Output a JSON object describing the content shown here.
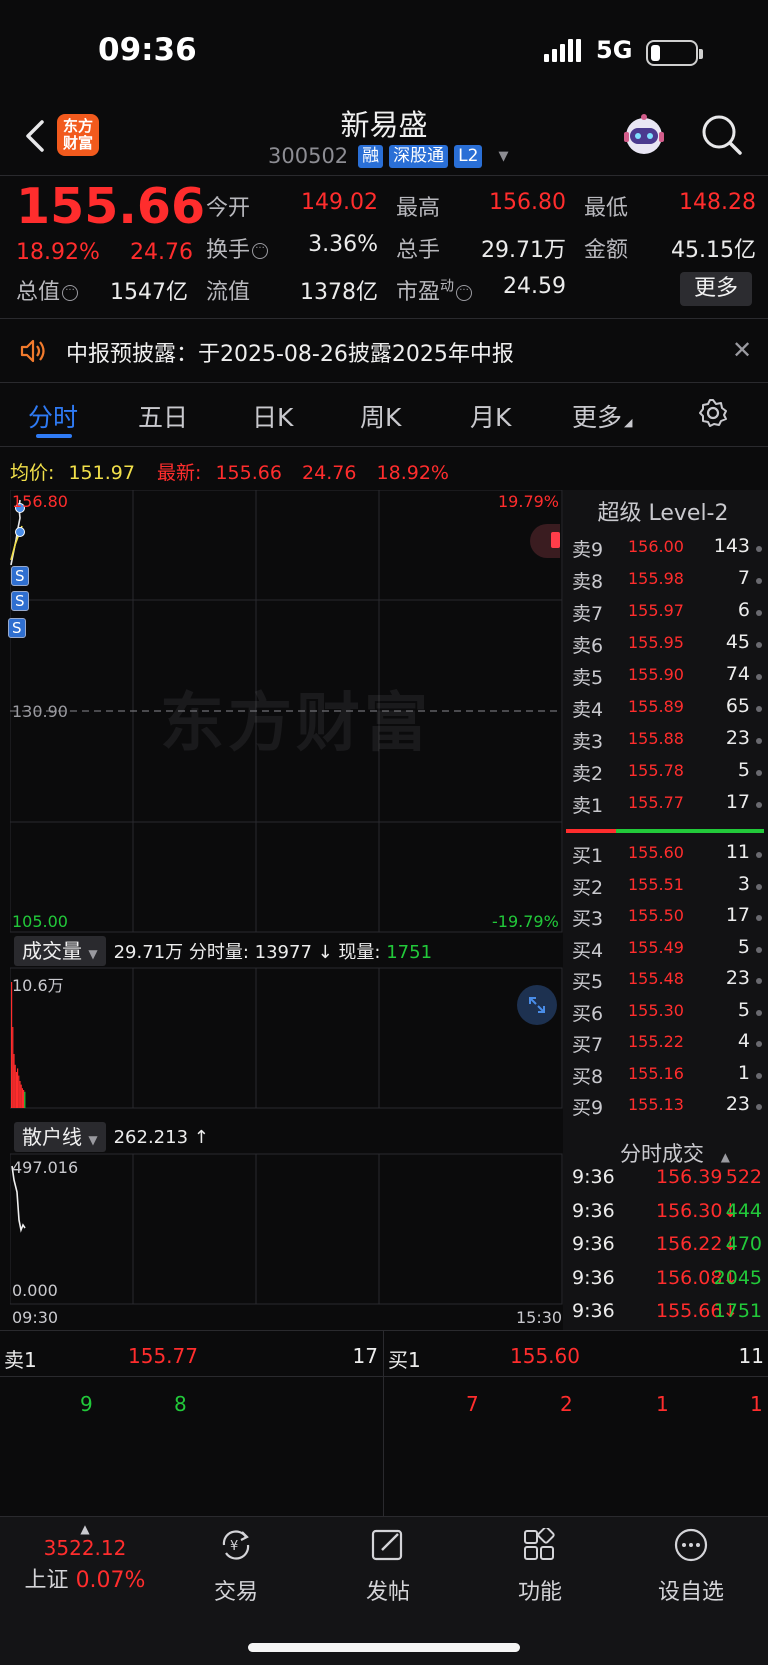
{
  "status_bar": {
    "time": "09:36",
    "network": "5G"
  },
  "header": {
    "stock_name": "新易盛",
    "stock_code": "300502",
    "tags": [
      "融",
      "深股通",
      "L2"
    ],
    "logo_text": [
      "东方",
      "财富"
    ]
  },
  "quote": {
    "price": "155.66",
    "change_pct": "18.92%",
    "change": "24.76",
    "fields": [
      {
        "label": "今开",
        "value": "149.02",
        "color": "red"
      },
      {
        "label": "最高",
        "value": "156.80",
        "color": "red"
      },
      {
        "label": "最低",
        "value": "148.28",
        "color": "red"
      },
      {
        "label": "换手",
        "value": "3.36%",
        "color": "white",
        "info": true
      },
      {
        "label": "总手",
        "value": "29.71万",
        "color": "white"
      },
      {
        "label": "金额",
        "value": "45.15亿",
        "color": "white"
      },
      {
        "label": "总值",
        "value": "1547亿",
        "color": "white",
        "info": true
      },
      {
        "label": "流值",
        "value": "1378亿",
        "color": "white"
      },
      {
        "label": "市盈",
        "sup": "动",
        "value": "24.59",
        "color": "white",
        "info": true
      }
    ],
    "more_label": "更多"
  },
  "notice": {
    "text": "中报预披露：于2025-08-26披露2025年中报"
  },
  "tabs": [
    "分时",
    "五日",
    "日K",
    "周K",
    "月K",
    "更多"
  ],
  "legend": {
    "avg_label": "均价:",
    "avg_value": "151.97",
    "latest_label": "最新:",
    "latest_value": "155.66",
    "latest_change": "24.76",
    "latest_pct": "18.92%"
  },
  "chart": {
    "watermark": "东方财富",
    "y_top": "156.80",
    "y_mid": "130.90",
    "y_bottom": "105.00",
    "pct_top": "19.79%",
    "pct_bottom": "-19.79%",
    "x_start": "09:30",
    "x_end": "15:30",
    "signals": [
      "S",
      "S",
      "S"
    ]
  },
  "volume": {
    "selector": "成交量",
    "summary": "29.71万 分时量: 13977 ↓ 现量:",
    "current": "1751",
    "max_label": "10.6万"
  },
  "retail": {
    "selector": "散户线",
    "value": "262.213 ↑",
    "max_label": "497.016",
    "min_label": "0.000"
  },
  "level2": {
    "title": "超级 Level-2",
    "asks": [
      {
        "label": "卖9",
        "price": "156.00",
        "vol": "143"
      },
      {
        "label": "卖8",
        "price": "155.98",
        "vol": "7"
      },
      {
        "label": "卖7",
        "price": "155.97",
        "vol": "6"
      },
      {
        "label": "卖6",
        "price": "155.95",
        "vol": "45"
      },
      {
        "label": "卖5",
        "price": "155.90",
        "vol": "74"
      },
      {
        "label": "卖4",
        "price": "155.89",
        "vol": "65"
      },
      {
        "label": "卖3",
        "price": "155.88",
        "vol": "23"
      },
      {
        "label": "卖2",
        "price": "155.78",
        "vol": "5"
      },
      {
        "label": "卖1",
        "price": "155.77",
        "vol": "17"
      }
    ],
    "bids": [
      {
        "label": "买1",
        "price": "155.60",
        "vol": "11"
      },
      {
        "label": "买2",
        "price": "155.51",
        "vol": "3"
      },
      {
        "label": "买3",
        "price": "155.50",
        "vol": "17"
      },
      {
        "label": "买4",
        "price": "155.49",
        "vol": "5"
      },
      {
        "label": "买5",
        "price": "155.48",
        "vol": "23"
      },
      {
        "label": "买6",
        "price": "155.30",
        "vol": "5"
      },
      {
        "label": "买7",
        "price": "155.22",
        "vol": "4"
      },
      {
        "label": "买8",
        "price": "155.16",
        "vol": "1"
      },
      {
        "label": "买9",
        "price": "155.13",
        "vol": "23"
      }
    ],
    "ticks_title": "分时成交",
    "ticks": [
      {
        "time": "9:36",
        "price": "156.39",
        "vol": "522",
        "vol_color": "red"
      },
      {
        "time": "9:36",
        "price": "156.30↓",
        "vol": "444",
        "vol_color": "green"
      },
      {
        "time": "9:36",
        "price": "156.22↓",
        "vol": "470",
        "vol_color": "green"
      },
      {
        "time": "9:36",
        "price": "156.08↓",
        "vol": "2045",
        "vol_color": "green"
      },
      {
        "time": "9:36",
        "price": "155.66↓",
        "vol": "1751",
        "vol_color": "green"
      }
    ]
  },
  "bottom_book": {
    "ask_label": "卖1",
    "ask_price": "155.77",
    "ask_vol": "17",
    "bid_label": "买1",
    "bid_price": "155.60",
    "bid_vol": "11",
    "ask_queue": [
      "9",
      "8"
    ],
    "bid_queue": [
      "7",
      "2",
      "1",
      "1"
    ]
  },
  "bottom_nav": {
    "index_value": "3522.12",
    "index_name": "上证",
    "index_pct": "0.07%",
    "items": [
      "交易",
      "发帖",
      "功能",
      "设自选"
    ]
  },
  "colors": {
    "up": "#ff2d2d",
    "down": "#22c93a",
    "accent": "#2f7bf5",
    "brand": "#f25a1d"
  }
}
